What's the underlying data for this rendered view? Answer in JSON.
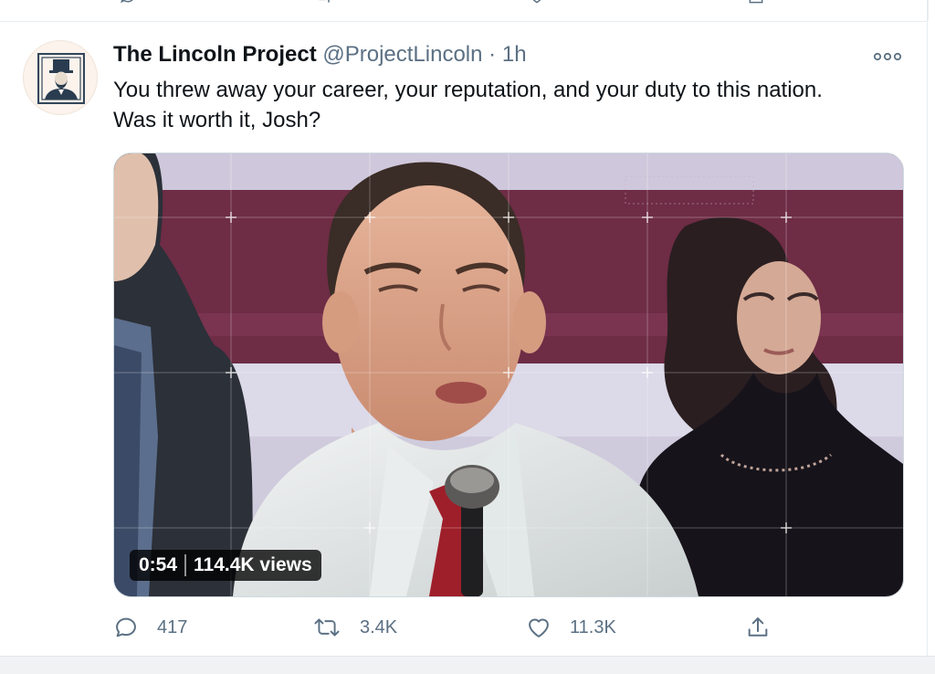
{
  "tweet": {
    "display_name": "The Lincoln Project",
    "handle": "@ProjectLincoln",
    "separator": "·",
    "time": "1h",
    "text": "You threw away your career, your reputation, and your duty to this nation. Was it worth it, Josh?",
    "avatar_icon": "lincoln-portrait-icon",
    "media": {
      "type": "video",
      "duration": "0:54",
      "views": "114.4K views"
    },
    "actions": {
      "reply_count": "417",
      "retweet_count": "3.4K",
      "like_count": "11.3K"
    }
  },
  "colors": {
    "text_primary": "#0f1419",
    "text_secondary": "#5b7083",
    "border": "#e6ecf0"
  }
}
